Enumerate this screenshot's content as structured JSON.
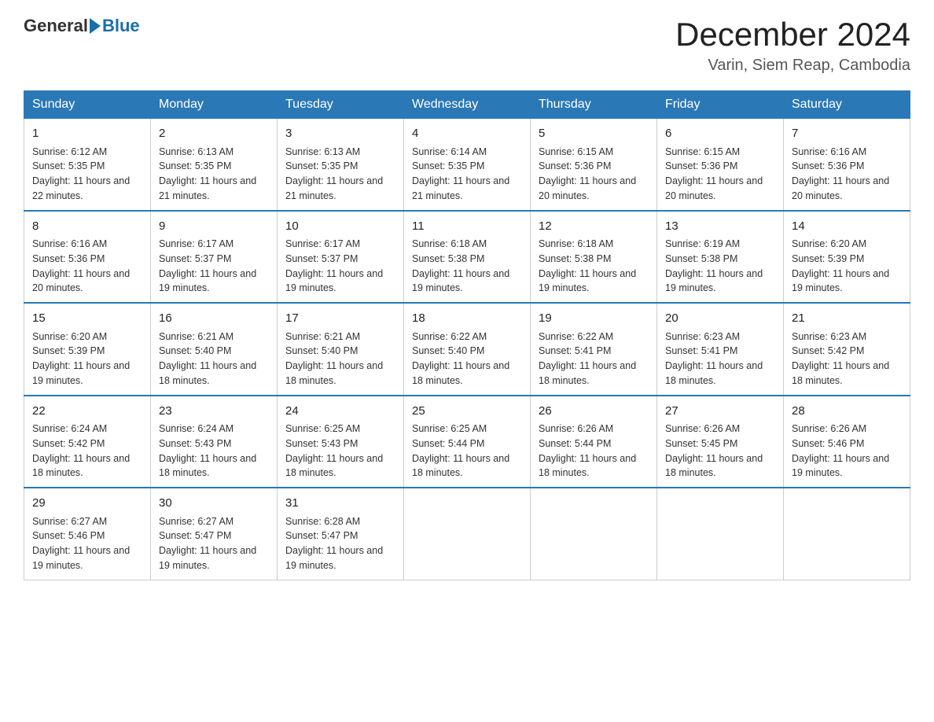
{
  "header": {
    "logo_general": "General",
    "logo_blue": "Blue",
    "month_title": "December 2024",
    "location": "Varin, Siem Reap, Cambodia"
  },
  "days_of_week": [
    "Sunday",
    "Monday",
    "Tuesday",
    "Wednesday",
    "Thursday",
    "Friday",
    "Saturday"
  ],
  "weeks": [
    [
      {
        "day": "1",
        "sunrise": "6:12 AM",
        "sunset": "5:35 PM",
        "daylight": "11 hours and 22 minutes."
      },
      {
        "day": "2",
        "sunrise": "6:13 AM",
        "sunset": "5:35 PM",
        "daylight": "11 hours and 21 minutes."
      },
      {
        "day": "3",
        "sunrise": "6:13 AM",
        "sunset": "5:35 PM",
        "daylight": "11 hours and 21 minutes."
      },
      {
        "day": "4",
        "sunrise": "6:14 AM",
        "sunset": "5:35 PM",
        "daylight": "11 hours and 21 minutes."
      },
      {
        "day": "5",
        "sunrise": "6:15 AM",
        "sunset": "5:36 PM",
        "daylight": "11 hours and 20 minutes."
      },
      {
        "day": "6",
        "sunrise": "6:15 AM",
        "sunset": "5:36 PM",
        "daylight": "11 hours and 20 minutes."
      },
      {
        "day": "7",
        "sunrise": "6:16 AM",
        "sunset": "5:36 PM",
        "daylight": "11 hours and 20 minutes."
      }
    ],
    [
      {
        "day": "8",
        "sunrise": "6:16 AM",
        "sunset": "5:36 PM",
        "daylight": "11 hours and 20 minutes."
      },
      {
        "day": "9",
        "sunrise": "6:17 AM",
        "sunset": "5:37 PM",
        "daylight": "11 hours and 19 minutes."
      },
      {
        "day": "10",
        "sunrise": "6:17 AM",
        "sunset": "5:37 PM",
        "daylight": "11 hours and 19 minutes."
      },
      {
        "day": "11",
        "sunrise": "6:18 AM",
        "sunset": "5:38 PM",
        "daylight": "11 hours and 19 minutes."
      },
      {
        "day": "12",
        "sunrise": "6:18 AM",
        "sunset": "5:38 PM",
        "daylight": "11 hours and 19 minutes."
      },
      {
        "day": "13",
        "sunrise": "6:19 AM",
        "sunset": "5:38 PM",
        "daylight": "11 hours and 19 minutes."
      },
      {
        "day": "14",
        "sunrise": "6:20 AM",
        "sunset": "5:39 PM",
        "daylight": "11 hours and 19 minutes."
      }
    ],
    [
      {
        "day": "15",
        "sunrise": "6:20 AM",
        "sunset": "5:39 PM",
        "daylight": "11 hours and 19 minutes."
      },
      {
        "day": "16",
        "sunrise": "6:21 AM",
        "sunset": "5:40 PM",
        "daylight": "11 hours and 18 minutes."
      },
      {
        "day": "17",
        "sunrise": "6:21 AM",
        "sunset": "5:40 PM",
        "daylight": "11 hours and 18 minutes."
      },
      {
        "day": "18",
        "sunrise": "6:22 AM",
        "sunset": "5:40 PM",
        "daylight": "11 hours and 18 minutes."
      },
      {
        "day": "19",
        "sunrise": "6:22 AM",
        "sunset": "5:41 PM",
        "daylight": "11 hours and 18 minutes."
      },
      {
        "day": "20",
        "sunrise": "6:23 AM",
        "sunset": "5:41 PM",
        "daylight": "11 hours and 18 minutes."
      },
      {
        "day": "21",
        "sunrise": "6:23 AM",
        "sunset": "5:42 PM",
        "daylight": "11 hours and 18 minutes."
      }
    ],
    [
      {
        "day": "22",
        "sunrise": "6:24 AM",
        "sunset": "5:42 PM",
        "daylight": "11 hours and 18 minutes."
      },
      {
        "day": "23",
        "sunrise": "6:24 AM",
        "sunset": "5:43 PM",
        "daylight": "11 hours and 18 minutes."
      },
      {
        "day": "24",
        "sunrise": "6:25 AM",
        "sunset": "5:43 PM",
        "daylight": "11 hours and 18 minutes."
      },
      {
        "day": "25",
        "sunrise": "6:25 AM",
        "sunset": "5:44 PM",
        "daylight": "11 hours and 18 minutes."
      },
      {
        "day": "26",
        "sunrise": "6:26 AM",
        "sunset": "5:44 PM",
        "daylight": "11 hours and 18 minutes."
      },
      {
        "day": "27",
        "sunrise": "6:26 AM",
        "sunset": "5:45 PM",
        "daylight": "11 hours and 18 minutes."
      },
      {
        "day": "28",
        "sunrise": "6:26 AM",
        "sunset": "5:46 PM",
        "daylight": "11 hours and 19 minutes."
      }
    ],
    [
      {
        "day": "29",
        "sunrise": "6:27 AM",
        "sunset": "5:46 PM",
        "daylight": "11 hours and 19 minutes."
      },
      {
        "day": "30",
        "sunrise": "6:27 AM",
        "sunset": "5:47 PM",
        "daylight": "11 hours and 19 minutes."
      },
      {
        "day": "31",
        "sunrise": "6:28 AM",
        "sunset": "5:47 PM",
        "daylight": "11 hours and 19 minutes."
      },
      null,
      null,
      null,
      null
    ]
  ],
  "labels": {
    "sunrise": "Sunrise:",
    "sunset": "Sunset:",
    "daylight": "Daylight:"
  }
}
